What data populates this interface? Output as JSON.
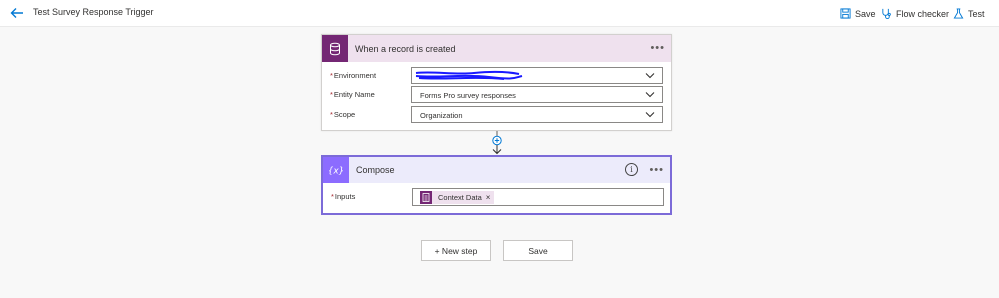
{
  "topbar": {
    "title": "Test Survey Response Trigger",
    "actions": [
      {
        "label": "Save",
        "icon": "save-icon"
      },
      {
        "label": "Flow checker",
        "icon": "stethoscope-icon"
      },
      {
        "label": "Test",
        "icon": "flask-icon"
      }
    ]
  },
  "trigger": {
    "title": "When a record is created",
    "icon": "database-icon",
    "accent": "#742774",
    "header_bg": "#efe1ee",
    "fields": [
      {
        "label": "Environment",
        "required": "*",
        "value": ""
      },
      {
        "label": "Entity Name",
        "required": "*",
        "value": "Forms Pro survey responses"
      },
      {
        "label": "Scope",
        "required": "*",
        "value": "Organization"
      }
    ]
  },
  "compose": {
    "title": "Compose",
    "icon": "curly-braces-icon",
    "accent": "#8c6cff",
    "inputs_label": "Inputs",
    "required": "*",
    "token": {
      "label": "Context Data",
      "remove": "×"
    }
  },
  "buttons": {
    "new_step": "+ New step",
    "save": "Save"
  }
}
